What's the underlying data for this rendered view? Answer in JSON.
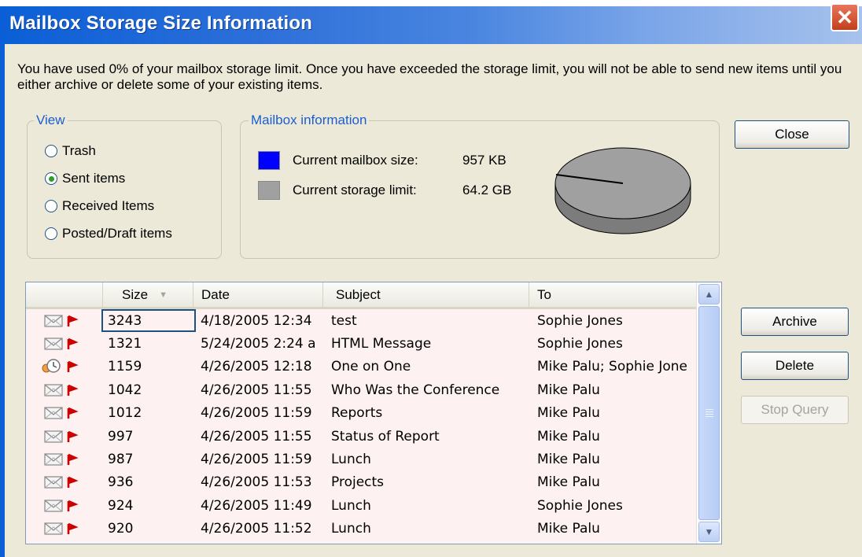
{
  "window": {
    "title": "Mailbox Storage Size Information",
    "close_glyph": "✕"
  },
  "message": "You have used 0% of your mailbox storage limit.  Once you have exceeded the storage limit, you will not be able to send new items until you either archive or delete some of your existing items.",
  "view": {
    "legend": "View",
    "options": [
      {
        "label": "Trash",
        "selected": false
      },
      {
        "label": "Sent items",
        "selected": true
      },
      {
        "label": "Received Items",
        "selected": false
      },
      {
        "label": "Posted/Draft items",
        "selected": false
      }
    ]
  },
  "mailbox_info": {
    "legend": "Mailbox information",
    "size_label": "Current mailbox size:",
    "size_value": "957 KB",
    "size_color": "#0000ff",
    "limit_label": "Current storage limit:",
    "limit_value": "64.2 GB",
    "limit_color": "#a0a0a0"
  },
  "buttons": {
    "close": "Close",
    "archive": "Archive",
    "delete": "Delete",
    "stop_query": "Stop Query"
  },
  "table": {
    "columns": [
      "Size",
      "Date",
      "Subject",
      "To"
    ],
    "rows": [
      {
        "icon": "envelope-icon",
        "size": "3243",
        "date": "4/18/2005 12:34",
        "subject": "test",
        "to": "Sophie Jones"
      },
      {
        "icon": "envelope-icon",
        "size": "1321",
        "date": "5/24/2005 2:24 a",
        "subject": "HTML Message",
        "to": "Sophie Jones"
      },
      {
        "icon": "meeting-clock-icon",
        "size": "1159",
        "date": "4/26/2005 12:18",
        "subject": "One on One",
        "to": "Mike Palu;  Sophie Jone"
      },
      {
        "icon": "envelope-icon",
        "size": "1042",
        "date": "4/26/2005 11:55",
        "subject": "Who Was the Conference",
        "to": "Mike Palu"
      },
      {
        "icon": "envelope-icon",
        "size": "1012",
        "date": "4/26/2005 11:59",
        "subject": "Reports",
        "to": "Mike Palu"
      },
      {
        "icon": "envelope-icon",
        "size": "997",
        "date": "4/26/2005 11:55",
        "subject": "Status of Report",
        "to": "Mike Palu"
      },
      {
        "icon": "envelope-icon",
        "size": "987",
        "date": "4/26/2005 11:59",
        "subject": "Lunch",
        "to": "Mike Palu"
      },
      {
        "icon": "envelope-icon",
        "size": "936",
        "date": "4/26/2005 11:53",
        "subject": "Projects",
        "to": "Mike Palu"
      },
      {
        "icon": "envelope-icon",
        "size": "924",
        "date": "4/26/2005 11:49",
        "subject": "Lunch",
        "to": "Sophie Jones"
      },
      {
        "icon": "envelope-icon",
        "size": "920",
        "date": "4/26/2005 11:52",
        "subject": "Lunch",
        "to": "Mike Palu"
      }
    ]
  },
  "chart_data": {
    "type": "pie",
    "categories": [
      "Current mailbox size",
      "Current storage limit"
    ],
    "values": [
      957,
      67319808
    ],
    "units": "KB",
    "colors": [
      "#0000ff",
      "#a0a0a0"
    ]
  }
}
